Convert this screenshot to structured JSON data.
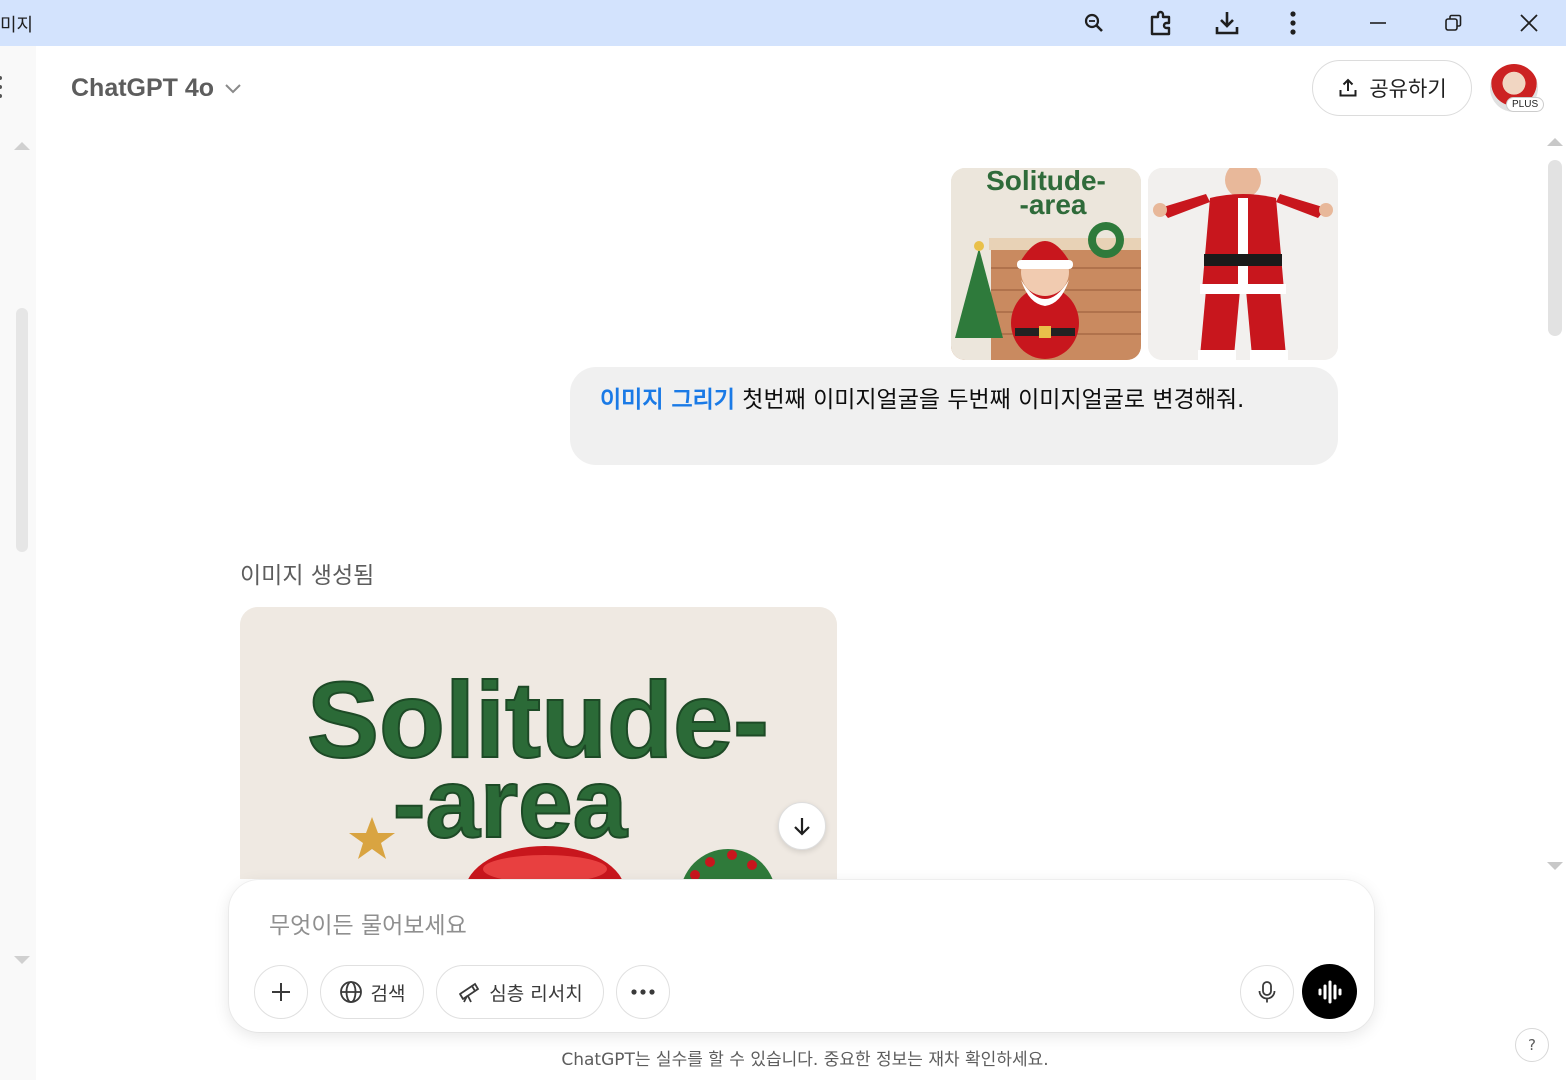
{
  "browser": {
    "tab_title": "미지",
    "icons": [
      "zoom-icon",
      "extensions-icon",
      "download-icon",
      "more-icon",
      "minimize-icon",
      "restore-icon",
      "close-icon"
    ]
  },
  "header": {
    "model_name": "ChatGPT 4o",
    "share_label": "공유하기",
    "plan_badge": "PLUS"
  },
  "conversation": {
    "user_images": [
      {
        "text_line1": "Solitude-",
        "text_line2": "-area"
      },
      {}
    ],
    "user_message": {
      "tool_label": "이미지 그리기",
      "text": " 첫번째 이미지얼굴을 두번째 이미지얼굴로 변경해줘."
    },
    "assistant": {
      "status": "이미지 생성됨",
      "image_text_line1": "Solitude-",
      "image_text_line2": "-area"
    }
  },
  "composer": {
    "placeholder": "무엇이든 물어보세요",
    "search_label": "검색",
    "research_label": "심층 리서치"
  },
  "footer": {
    "disclaimer": "ChatGPT는 실수를 할 수 있습니다. 중요한 정보는 재차 확인하세요.",
    "help_label": "?"
  },
  "colors": {
    "titlebar": "#d3e3fd",
    "tool_accent": "#1a7ae6",
    "bubble": "#f0f0f0",
    "santa_red": "#c8161d",
    "title_green": "#2f6b3a"
  }
}
